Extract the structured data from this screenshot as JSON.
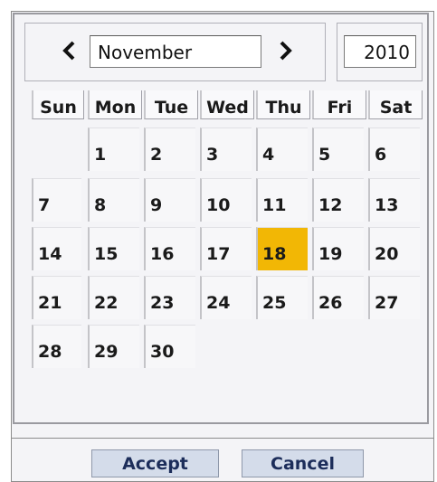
{
  "header": {
    "month": "November",
    "year": "2010",
    "prev_icon": "chevron-left-icon",
    "next_icon": "chevron-right-icon"
  },
  "weekdays": [
    "Sun",
    "Mon",
    "Tue",
    "Wed",
    "Thu",
    "Fri",
    "Sat"
  ],
  "weeks": [
    [
      "",
      "1",
      "2",
      "3",
      "4",
      "5",
      "6"
    ],
    [
      "7",
      "8",
      "9",
      "10",
      "11",
      "12",
      "13"
    ],
    [
      "14",
      "15",
      "16",
      "17",
      "18",
      "19",
      "20"
    ],
    [
      "21",
      "22",
      "23",
      "24",
      "25",
      "26",
      "27"
    ],
    [
      "28",
      "29",
      "30",
      "",
      "",
      "",
      ""
    ]
  ],
  "selected_day": "18",
  "colors": {
    "selected": "#f2b705",
    "button_bg": "#d4dcea",
    "button_text": "#1c2d5a"
  },
  "footer": {
    "accept_label": "Accept",
    "cancel_label": "Cancel"
  }
}
